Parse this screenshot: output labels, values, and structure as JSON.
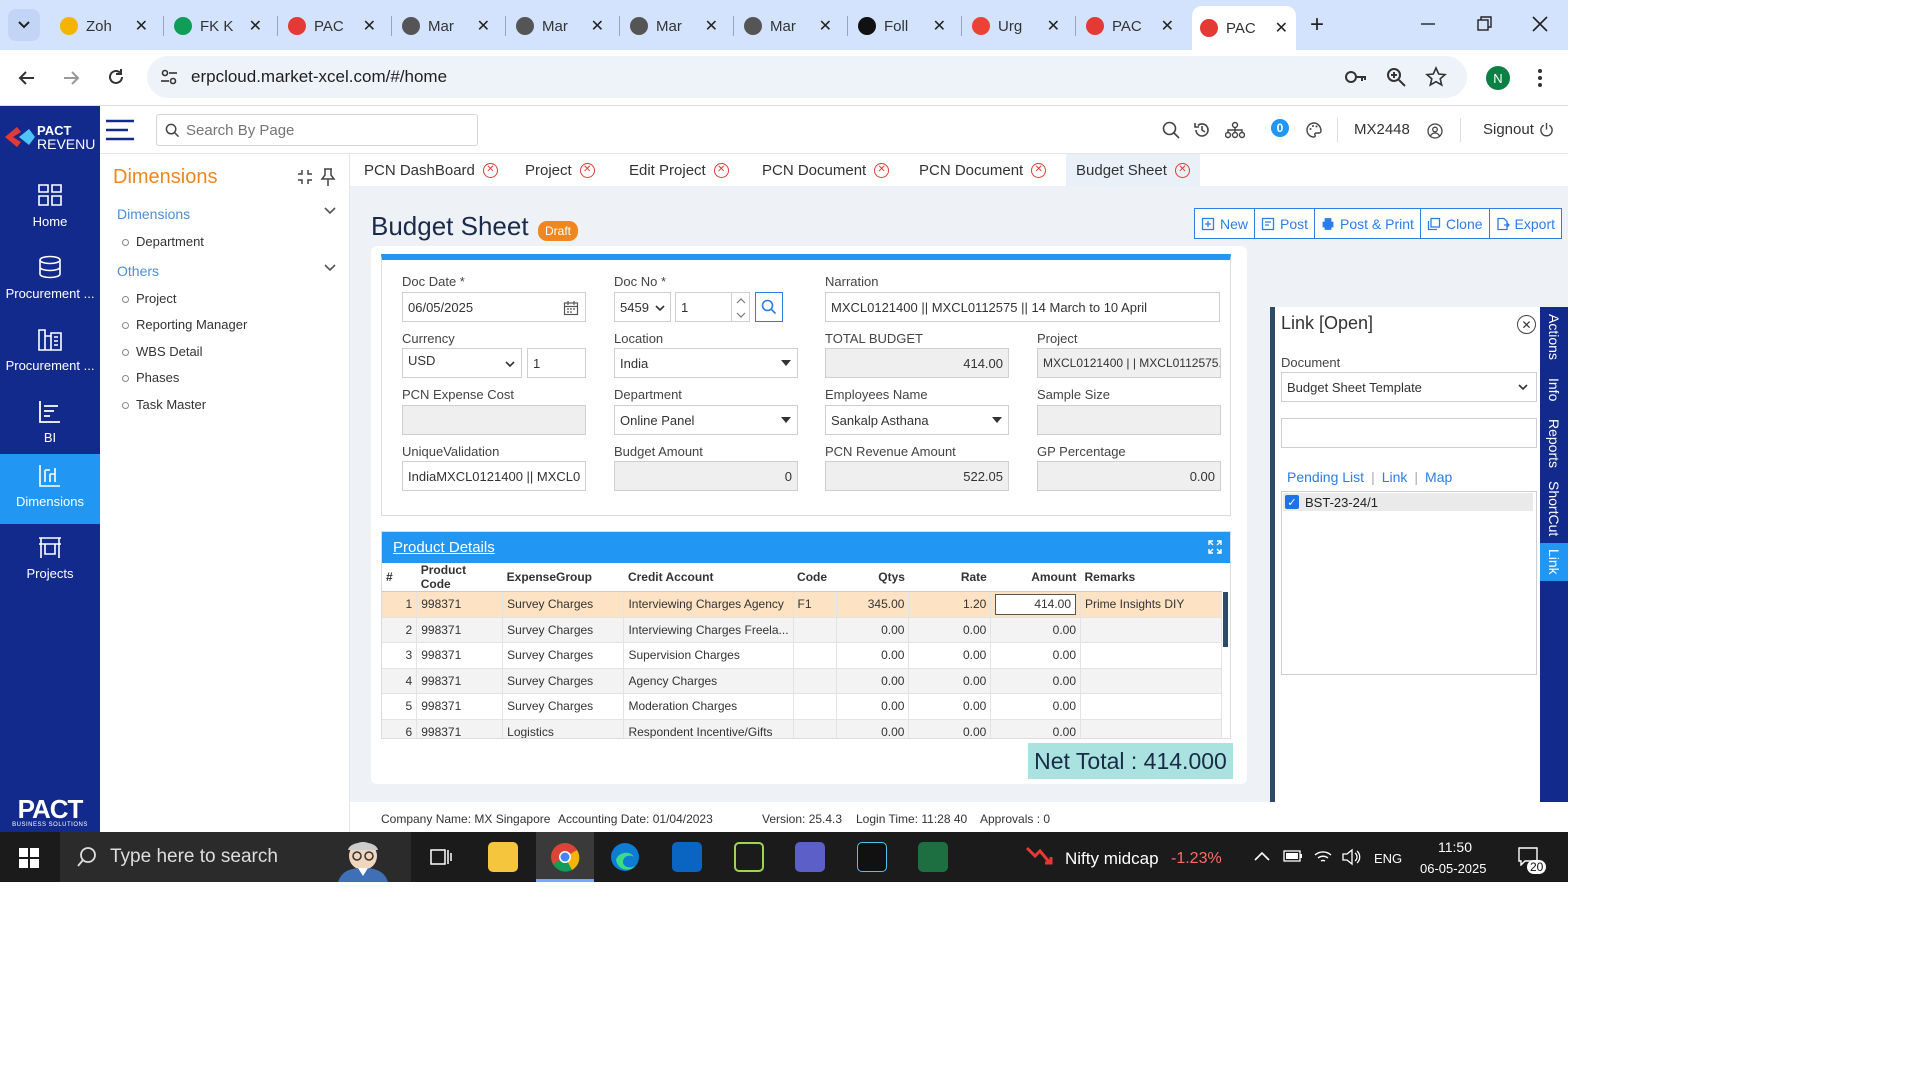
{
  "browser": {
    "tabs": [
      {
        "title": "Zoh",
        "icon": "zoho-icon",
        "color": "#f4b400"
      },
      {
        "title": "FK K",
        "icon": "sheets-icon",
        "color": "#0f9d58"
      },
      {
        "title": "PAC",
        "icon": "pact-icon",
        "color": "#e53935"
      },
      {
        "title": "Mar",
        "icon": "globe-icon",
        "color": "#555555"
      },
      {
        "title": "Mar",
        "icon": "globe-icon",
        "color": "#555555"
      },
      {
        "title": "Mar",
        "icon": "globe-icon",
        "color": "#555555"
      },
      {
        "title": "Mar",
        "icon": "globe-icon",
        "color": "#555555"
      },
      {
        "title": "Foll",
        "icon": "openai-icon",
        "color": "#111111"
      },
      {
        "title": "Urg",
        "icon": "gmail-icon",
        "color": "#ea4335"
      },
      {
        "title": "PAC",
        "icon": "pact-icon",
        "color": "#e53935"
      },
      {
        "title": "PAC",
        "icon": "pact-icon",
        "color": "#e53935"
      }
    ],
    "url": "erpcloud.market-xcel.com/#/home",
    "profile_initial": "N"
  },
  "header": {
    "search_placeholder": "Search By Page",
    "notification_count": "0",
    "user_code": "MX2448",
    "signout_label": "Signout",
    "logo_text_top": "PACT",
    "logo_text_bottom": "REVENU"
  },
  "rail": {
    "items": [
      {
        "label": "Home",
        "icon": "home-grid-icon"
      },
      {
        "label": "Procurement ...",
        "icon": "database-icon"
      },
      {
        "label": "Procurement ...",
        "icon": "procurement-icon"
      },
      {
        "label": "BI",
        "icon": "bi-chart-icon"
      },
      {
        "label": "Dimensions",
        "icon": "dimensions-icon"
      },
      {
        "label": "Projects",
        "icon": "projects-icon"
      }
    ],
    "footer_logo": "PACT",
    "footer_tagline": "BUSINESS SOLUTIONS"
  },
  "dimensions": {
    "title": "Dimensions",
    "sections": [
      {
        "label": "Dimensions",
        "items": [
          "Department"
        ]
      },
      {
        "label": "Others",
        "items": [
          "Project",
          "Reporting Manager",
          "WBS Detail",
          "Phases",
          "Task Master"
        ]
      }
    ]
  },
  "worktabs": [
    "PCN DashBoard",
    "Project",
    "Edit Project",
    "PCN Document",
    "PCN Document",
    "Budget Sheet"
  ],
  "page": {
    "title": "Budget Sheet",
    "status_badge": "Draft",
    "actions": [
      "New",
      "Post",
      "Post & Print",
      "Clone",
      "Export"
    ]
  },
  "form": {
    "doc_date_label": "Doc Date *",
    "doc_date": "06/05/2025",
    "doc_no_label": "Doc No *",
    "doc_no_series": "5459",
    "doc_no_value": "1",
    "narration_label": "Narration",
    "narration": "MXCL0121400 || MXCL0112575 || 14 March to 10 April",
    "currency_label": "Currency",
    "currency": "USD",
    "currency_rate": "1",
    "location_label": "Location",
    "location": "India",
    "total_budget_label": "TOTAL BUDGET",
    "total_budget": "414.00",
    "project_label": "Project",
    "project": "MXCL0121400 | | MXCL0112575...",
    "pcn_expense_label": "PCN Expense Cost",
    "pcn_expense": "",
    "department_label": "Department",
    "department": "Online Panel",
    "employee_label": "Employees Name",
    "employee": "Sankalp Asthana",
    "sample_size_label": "Sample Size",
    "sample_size": "",
    "unique_label": "UniqueValidation",
    "unique_value": "IndiaMXCL0121400 || MXCL0",
    "budget_amount_label": "Budget Amount",
    "budget_amount": "0",
    "pcn_revenue_label": "PCN Revenue Amount",
    "pcn_revenue": "522.05",
    "gp_label": "GP Percentage",
    "gp": "0.00"
  },
  "product_details": {
    "title": "Product Details",
    "columns": [
      "#",
      "Product Code",
      "ExpenseGroup",
      "Credit Account",
      "Code",
      "Qtys",
      "Rate",
      "Amount",
      "Remarks"
    ],
    "rows": [
      [
        "1",
        "998371",
        "Survey Charges",
        "Interviewing Charges Agency",
        "F1",
        "345.00",
        "1.20",
        "414.00",
        "Prime Insights DIY"
      ],
      [
        "2",
        "998371",
        "Survey Charges",
        "Interviewing Charges Freela...",
        "",
        "0.00",
        "0.00",
        "0.00",
        ""
      ],
      [
        "3",
        "998371",
        "Survey Charges",
        "Supervision Charges",
        "",
        "0.00",
        "0.00",
        "0.00",
        ""
      ],
      [
        "4",
        "998371",
        "Survey Charges",
        "Agency Charges",
        "",
        "0.00",
        "0.00",
        "0.00",
        ""
      ],
      [
        "5",
        "998371",
        "Survey Charges",
        "Moderation Charges",
        "",
        "0.00",
        "0.00",
        "0.00",
        ""
      ],
      [
        "6",
        "998371",
        "Logistics",
        "Respondent Incentive/Gifts",
        "",
        "0.00",
        "0.00",
        "0.00",
        ""
      ]
    ],
    "net_total": "Net Total : 414.000"
  },
  "link_panel": {
    "title": "Link [Open]",
    "document_label": "Document",
    "document_value": "Budget Sheet Template",
    "search_value": "",
    "subtabs": [
      "Pending List",
      "Link",
      "Map"
    ],
    "items": [
      "BST-23-24/1"
    ]
  },
  "side_tabs": [
    "Actions",
    "Info",
    "Reports",
    "ShortCut",
    "Link"
  ],
  "status": {
    "company": "Company Name: MX Singapore",
    "accounting_date": "Accounting Date: 01/04/2023",
    "version": "Version: 25.4.3",
    "login_time": "Login Time: 11:28 40",
    "approvals": "Approvals : 0"
  },
  "taskbar": {
    "search_placeholder": "Type here to search",
    "ticker_name": "Nifty midcap",
    "ticker_change": "-1.23%",
    "language": "ENG",
    "time": "11:50",
    "date": "06-05-2025",
    "notifications": "20"
  },
  "colors": {
    "rail": "#122a8c",
    "accent_blue": "#2196f3",
    "orange": "#f0861e",
    "selected_row": "#fde3c3",
    "net_total_bg": "#a9e2df"
  }
}
